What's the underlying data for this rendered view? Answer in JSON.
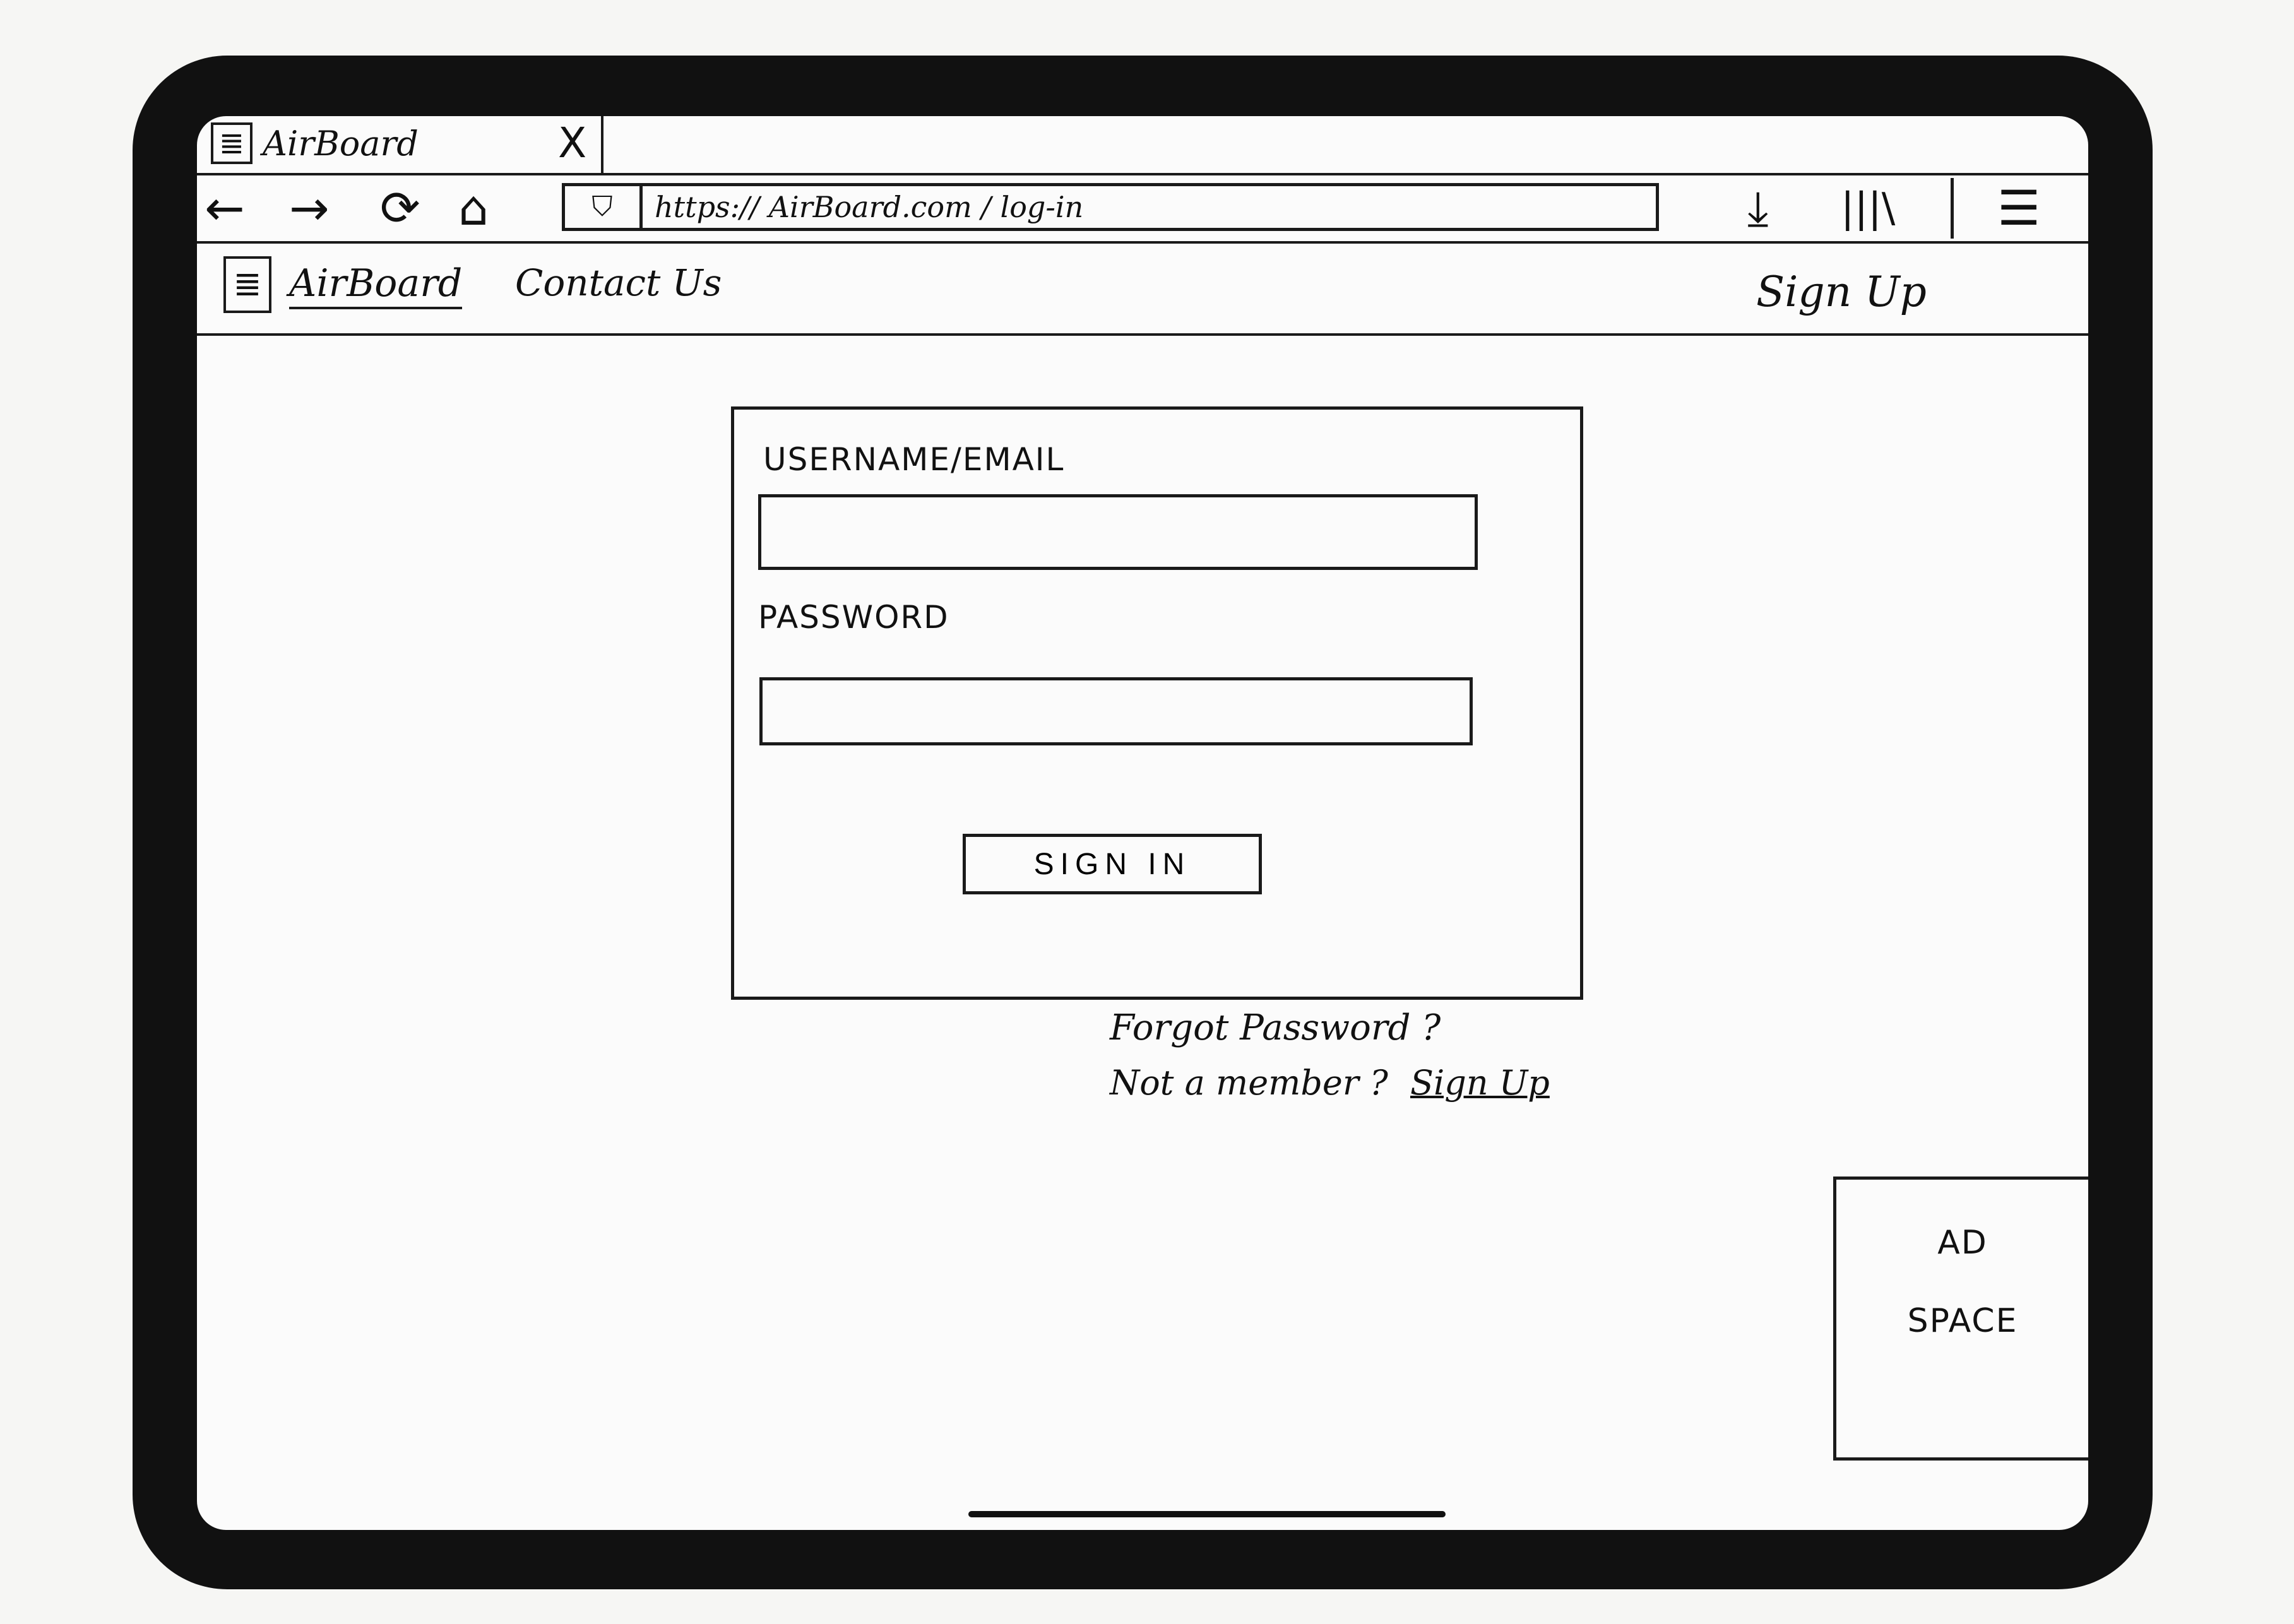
{
  "browser": {
    "tab_title": "AirBoard",
    "tab_close": "X",
    "url": "https:// AirBoard.com / log-in"
  },
  "site": {
    "name": "AirBoard",
    "nav_contact": "Contact Us",
    "nav_signup": "Sign Up"
  },
  "login": {
    "username_label": "USERNAME/EMAIL",
    "password_label": "PASSWORD",
    "username_value": "",
    "password_value": "",
    "signin_label": "SIGN IN",
    "forgot": "Forgot Password ?",
    "member_prompt": "Not a member ?",
    "member_link": "Sign Up"
  },
  "ad": {
    "line1": "AD",
    "line2": "SPACE"
  },
  "icons": {
    "back": "back-arrow-icon",
    "forward": "forward-arrow-icon",
    "reload": "reload-icon",
    "home": "home-icon",
    "shield": "shield-icon",
    "download": "download-icon",
    "library": "library-icon",
    "menu": "hamburger-menu-icon"
  }
}
